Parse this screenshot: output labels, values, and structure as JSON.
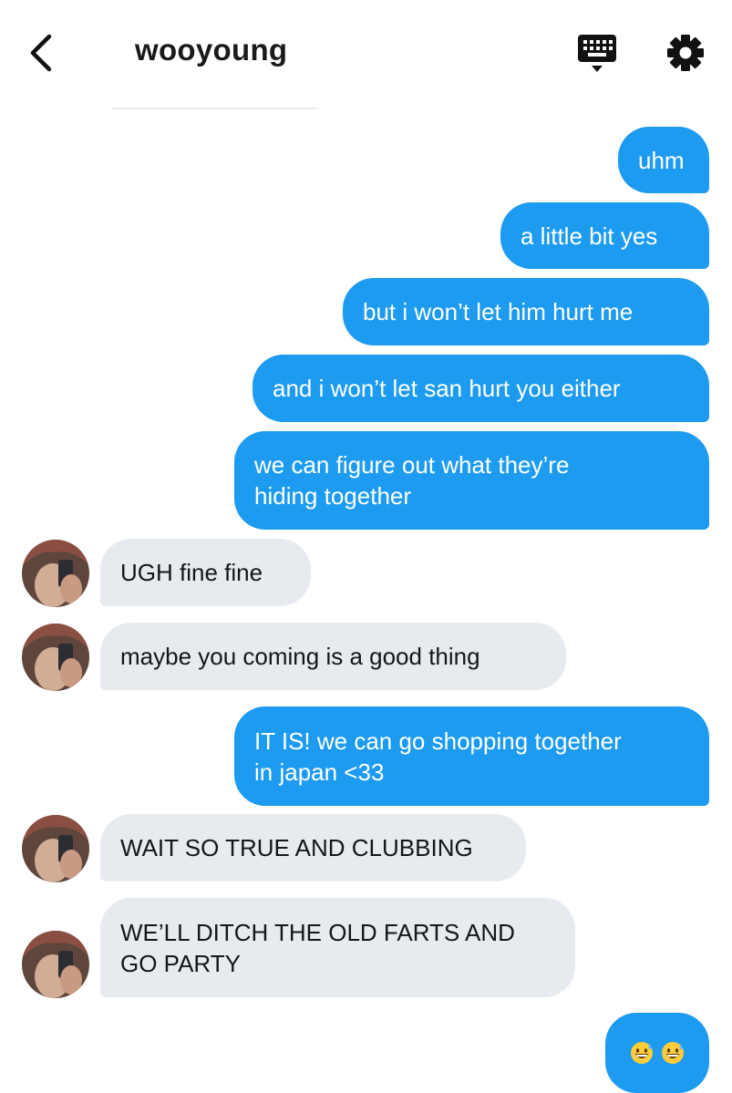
{
  "header": {
    "title": "wooyoung",
    "back_icon": "chevron-left-icon",
    "keyboard_icon": "keyboard-icon",
    "settings_icon": "gear-icon"
  },
  "colors": {
    "outgoing_bubble": "#1d9bf0",
    "incoming_bubble": "#e7ebf0",
    "outgoing_text": "#ffffff",
    "incoming_text": "#14171a"
  },
  "messages": [
    {
      "direction": "outgoing",
      "text": "uhm"
    },
    {
      "direction": "outgoing",
      "text": "a little bit yes"
    },
    {
      "direction": "outgoing",
      "text": "but i won’t let him hurt me"
    },
    {
      "direction": "outgoing",
      "text": "and i won’t let san hurt you either"
    },
    {
      "direction": "outgoing",
      "text": "we can figure out what they’re\nhiding together"
    },
    {
      "direction": "incoming",
      "text": "UGH fine fine"
    },
    {
      "direction": "incoming",
      "text": "maybe you coming is a good thing"
    },
    {
      "direction": "outgoing",
      "text": "IT IS! we can go shopping together\nin japan <33"
    },
    {
      "direction": "incoming",
      "text": "WAIT SO TRUE AND CLUBBING"
    },
    {
      "direction": "incoming",
      "text": "WE’LL DITCH THE OLD FARTS AND\nGO PARTY"
    },
    {
      "direction": "outgoing",
      "text": "",
      "emoji": [
        "grinning-sweat-emoji",
        "grinning-sweat-emoji"
      ]
    }
  ]
}
